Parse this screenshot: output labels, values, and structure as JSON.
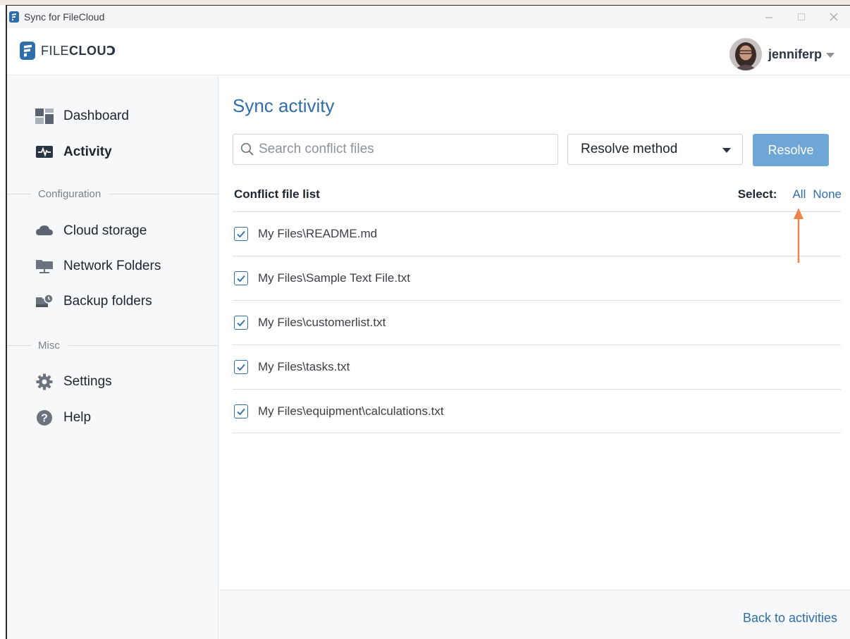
{
  "window": {
    "title": "Sync for FileCloud",
    "controls": [
      "minimize",
      "maximize",
      "close"
    ]
  },
  "header": {
    "logo_light": "FILE",
    "logo_bold": "CLOU",
    "logo_tail": "Ↄ",
    "username": "jenniferp"
  },
  "sidebar": {
    "items": [
      {
        "label": "Dashboard",
        "icon": "dashboard-icon",
        "active": false
      },
      {
        "label": "Activity",
        "icon": "activity-icon",
        "active": true
      }
    ],
    "config_label": "Configuration",
    "config_items": [
      {
        "label": "Cloud storage",
        "icon": "cloud-icon"
      },
      {
        "label": "Network Folders",
        "icon": "network-folder-icon"
      },
      {
        "label": "Backup folders",
        "icon": "backup-folder-icon"
      }
    ],
    "misc_label": "Misc",
    "misc_items": [
      {
        "label": "Settings",
        "icon": "gear-icon"
      },
      {
        "label": "Help",
        "icon": "help-icon"
      }
    ]
  },
  "main": {
    "title": "Sync activity",
    "search_placeholder": "Search conflict files",
    "resolve_method": "Resolve method",
    "resolve_button": "Resolve",
    "list_header": "Conflict file list",
    "select_label": "Select:",
    "select_all": "All",
    "select_none": "None",
    "files": [
      {
        "path": "My Files\\README.md",
        "checked": true
      },
      {
        "path": "My Files\\Sample Text File.txt",
        "checked": true
      },
      {
        "path": "My Files\\customerlist.txt",
        "checked": true
      },
      {
        "path": "My Files\\tasks.txt",
        "checked": true
      },
      {
        "path": "My Files\\equipment\\calculations.txt",
        "checked": true
      }
    ]
  },
  "footer": {
    "back_link": "Back to activities"
  },
  "colors": {
    "accent": "#2f6ea8",
    "button": "#6ea6d6",
    "annotation_arrow": "#f0834a",
    "sidebar_bg": "#f7f8f9"
  }
}
